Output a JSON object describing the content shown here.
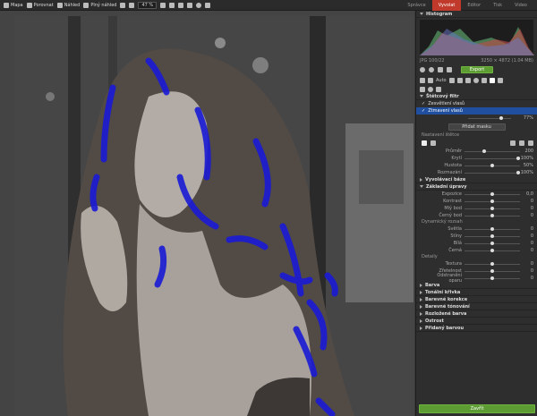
{
  "toolbar": {
    "map": "Mapa",
    "compare": "Porovnat",
    "preview": "Náhled",
    "full_view": "Plný náhled",
    "zoom": "47 %"
  },
  "tabs": {
    "manager": "Správce",
    "develop": "Vyvolat",
    "editor": "Editor",
    "print": "Tisk",
    "video": "Video"
  },
  "colors": {
    "accent": "#c0392b",
    "selection": "#1f4f9e",
    "mask_overlay": "#1a1ad6",
    "export": "#5c9c32"
  },
  "histogram": {
    "title": "Histogram",
    "format": "JPG",
    "zoom": "100/22",
    "dimensions": "3250 × 4872 (1.04 MB)"
  },
  "toolrow": {
    "auto": "Auto",
    "export": "Export"
  },
  "filter": {
    "title": "Štětcový filtr",
    "layers": [
      {
        "label": "Zesvětlení vlasů",
        "checked": true
      },
      {
        "label": "Ztmavení vlasů",
        "checked": true
      }
    ],
    "opacity": "77%",
    "opacity_level": 0.77,
    "add_mask": "Přidat masku"
  },
  "brush": {
    "title": "Nastavení štětce",
    "params": [
      {
        "label": "Průměr",
        "value": "200",
        "level": 0.35
      },
      {
        "label": "Krytí",
        "value": "100%",
        "level": 1.0
      },
      {
        "label": "Hustota",
        "value": "50%",
        "level": 0.5
      },
      {
        "label": "Rozmazání",
        "value": "100%",
        "level": 1.0
      }
    ]
  },
  "sections": {
    "develop_base": "Vyvolávací báze",
    "basic": "Základní úpravy",
    "dynamic": "Dynamický rozsah",
    "details": "Detaily"
  },
  "basic_params": [
    {
      "label": "Expozice",
      "value": "0,0",
      "level": 0.5
    },
    {
      "label": "Kontrast",
      "value": "0",
      "level": 0.5
    },
    {
      "label": "Mlý bod",
      "value": "0",
      "level": 0.5
    },
    {
      "label": "Černý bod",
      "value": "0",
      "level": 0.5
    }
  ],
  "dynamic_params": [
    {
      "label": "Světla",
      "value": "0",
      "level": 0.5
    },
    {
      "label": "Stíny",
      "value": "0",
      "level": 0.5
    },
    {
      "label": "Bílá",
      "value": "0",
      "level": 0.5
    },
    {
      "label": "Černá",
      "value": "0",
      "level": 0.5
    }
  ],
  "detail_params": [
    {
      "label": "Textura",
      "value": "0",
      "level": 0.5
    },
    {
      "label": "Zřetelnost",
      "value": "0",
      "level": 0.5
    },
    {
      "label": "Odstranění oparu",
      "value": "0",
      "level": 0.5
    }
  ],
  "collapsed": [
    "Barva",
    "Tonální křivka",
    "Barevné korekce",
    "Barevné tónování",
    "Rozložené barva",
    "Ostrost",
    "Přidaný barvou"
  ],
  "close": "Zavřít"
}
